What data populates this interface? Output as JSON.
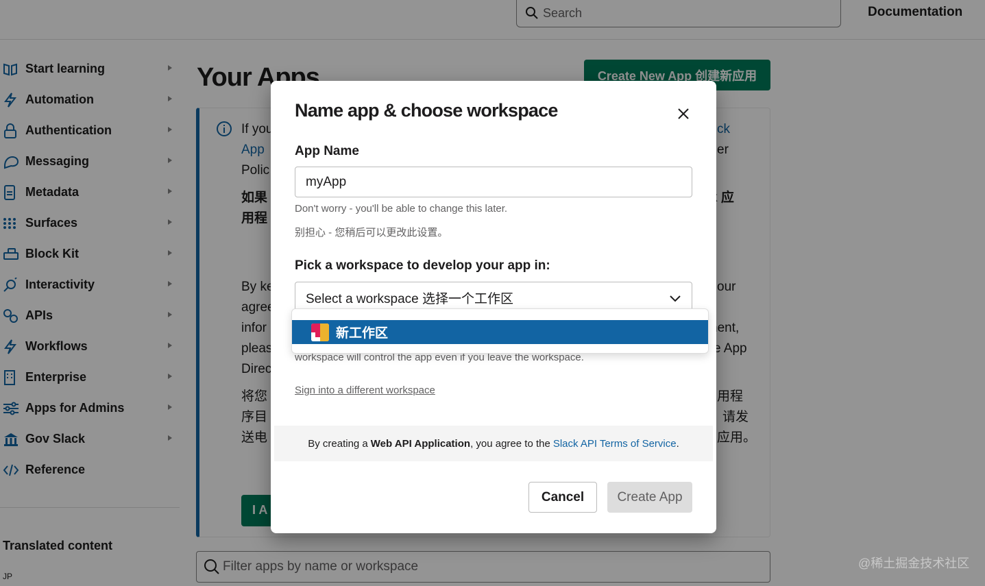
{
  "topbar": {
    "search_placeholder": "Search",
    "documentation": "Documentation"
  },
  "sidebar": {
    "items": [
      {
        "label": "Start learning",
        "icon": "book-icon"
      },
      {
        "label": "Automation",
        "icon": "bolt-icon"
      },
      {
        "label": "Authentication",
        "icon": "lock-icon"
      },
      {
        "label": "Messaging",
        "icon": "messages-icon"
      },
      {
        "label": "Metadata",
        "icon": "document-icon"
      },
      {
        "label": "Surfaces",
        "icon": "grid-icon"
      },
      {
        "label": "Block Kit",
        "icon": "blocks-icon"
      },
      {
        "label": "Interactivity",
        "icon": "interactivity-icon"
      },
      {
        "label": "APIs",
        "icon": "api-icon"
      },
      {
        "label": "Workflows",
        "icon": "workflow-icon"
      },
      {
        "label": "Enterprise",
        "icon": "building-icon"
      },
      {
        "label": "Apps for Admins",
        "icon": "sliders-icon"
      },
      {
        "label": "Gov Slack",
        "icon": "government-icon"
      },
      {
        "label": "Reference",
        "icon": "code-icon"
      }
    ],
    "translated_content": "Translated content",
    "lang": "JP"
  },
  "main": {
    "title": "Your Apps",
    "create_new_app": "Create New App 创建新应用",
    "notice_fragments": {
      "l1": "If you",
      "l2": "App",
      "l3": "Polic",
      "l4": "如果",
      "l5": "用程",
      "l6": "By ke",
      "l7": "agree",
      "l8": "infor",
      "l9": "pleas",
      "l10": "Direc",
      "l11": "将您",
      "l12": "序目",
      "l13": "送电",
      "r1": "ck",
      "r2": "er",
      "r3": "k 应",
      "r4": "our",
      "r5": "nent,",
      "r6": "e App",
      "r7": "用程",
      "r8": "请发",
      "r9": "应用。"
    },
    "agree_button": "I A",
    "filter_placeholder": "Filter apps by name or workspace",
    "watermark": "@稀土掘金技术社区"
  },
  "modal": {
    "title": "Name app & choose workspace",
    "app_name_label": "App Name",
    "app_name_value": "myApp",
    "hint_en": "Don't worry - you'll be able to change this later.",
    "hint_zh": "别担心 - 您稍后可以更改此设置。",
    "workspace_label": "Pick a workspace to develop your app in:",
    "workspace_select": "Select a workspace 选择一个工作区",
    "workspace_option": "新工作区",
    "partial_text": "workspace will control the app even if you leave the workspace.",
    "sign_in_link": "Sign into a different workspace",
    "tos_prefix": "By creating a",
    "tos_bold": "Web API Application",
    "tos_middle": ", you agree to the",
    "tos_link": "Slack API Terms of Service",
    "tos_suffix": ".",
    "cancel": "Cancel",
    "create": "Create App"
  },
  "colors": {
    "accent": "#1264a3",
    "brand_green": "#007a5a"
  }
}
